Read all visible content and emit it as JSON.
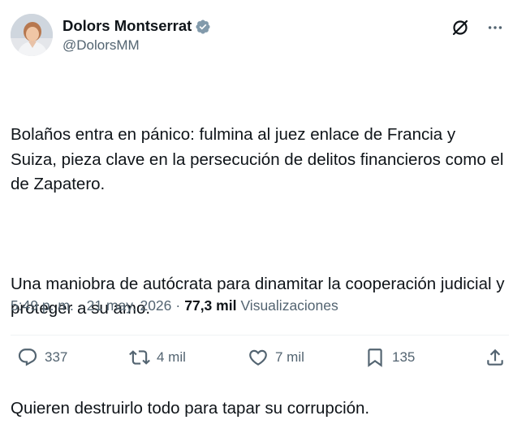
{
  "author": {
    "display_name": "Dolors Montserrat",
    "handle": "@DolorsMM",
    "verified_badge_color": "#829aab"
  },
  "icons": {
    "avatar": "profile-photo",
    "verified": "verified-badge-icon",
    "grok": "grok-icon",
    "more": "more-icon",
    "reply": "reply-icon",
    "repost": "repost-icon",
    "like": "like-icon",
    "bookmark": "bookmark-icon",
    "share": "share-icon"
  },
  "post": {
    "paragraphs": [
      "Bolaños entra en pánico: fulmina al juez enlace de Francia y Suiza, pieza clave en la persecución de delitos financieros como el de Zapatero.",
      "Una maniobra de autócrata para dinamitar la cooperación judicial y proteger a su amo.",
      "Quieren destruirlo todo para tapar su corrupción."
    ]
  },
  "meta": {
    "time": "5:49 p. m.",
    "separator": "·",
    "date": "21 may. 2026",
    "views_count": "77,3 mil",
    "views_label": "Visualizaciones"
  },
  "actions": {
    "replies": "337",
    "reposts": "4 mil",
    "likes": "7 mil",
    "bookmarks": "135"
  },
  "colors": {
    "text": "#0f1419",
    "secondary": "#536471",
    "divider": "#eff3f4"
  }
}
